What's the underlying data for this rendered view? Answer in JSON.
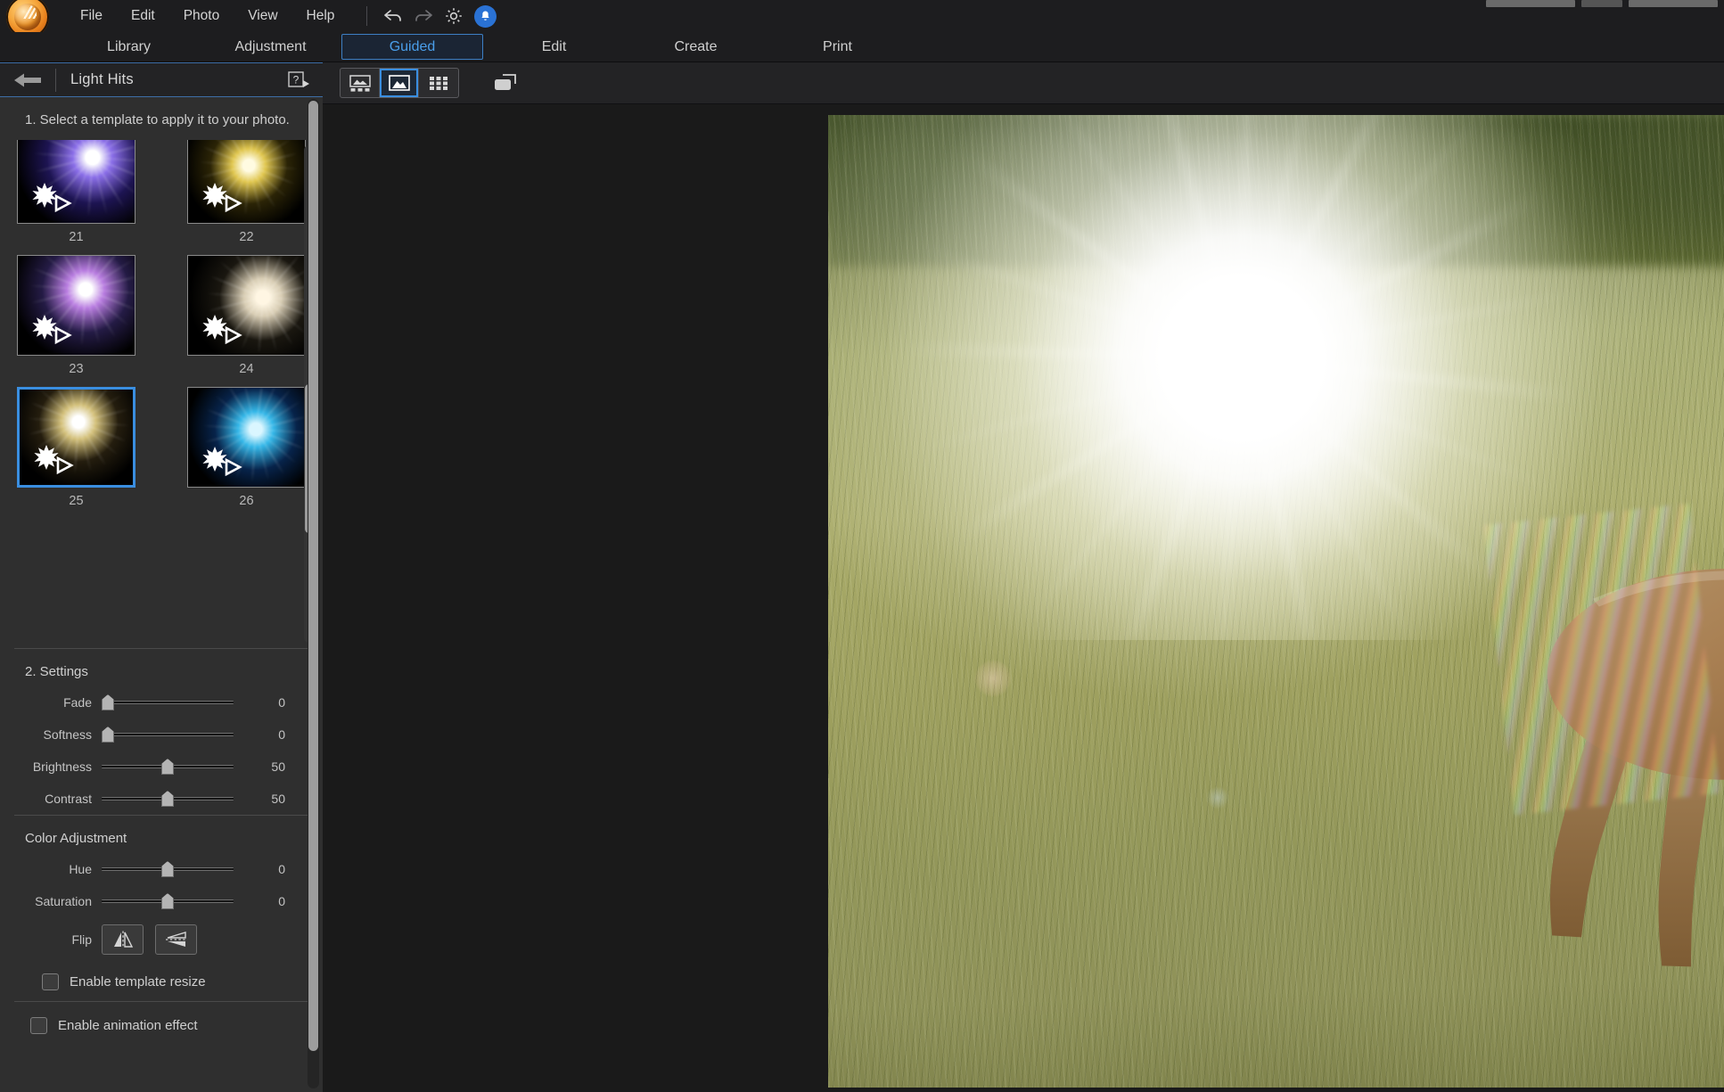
{
  "app": {
    "menu": [
      "File",
      "Edit",
      "Photo",
      "View",
      "Help"
    ],
    "icons": {
      "undo": "undo-icon",
      "redo": "redo-icon",
      "settings": "gear-icon",
      "notification": "bell-icon",
      "logo": "app-logo-icon"
    }
  },
  "tabs": [
    {
      "label": "Library",
      "active": false
    },
    {
      "label": "Adjustment",
      "active": false
    },
    {
      "label": "Guided",
      "active": true
    },
    {
      "label": "Edit",
      "active": false
    },
    {
      "label": "Create",
      "active": false
    },
    {
      "label": "Print",
      "active": false
    }
  ],
  "left_panel": {
    "back_icon": "back-arrow-icon",
    "title": "Light Hits",
    "help_icon": "help-question-icon",
    "step1_text": "1. Select a template to apply it to your photo.",
    "templates": [
      {
        "id": "19",
        "selected": false,
        "partial": true,
        "core": "#ffffff",
        "glow": "#7a5fd6",
        "tint": "#2a1b55"
      },
      {
        "id": "20",
        "selected": false,
        "partial": true,
        "core": "#ffffff",
        "glow": "#d9c24a",
        "tint": "#2a2408"
      },
      {
        "id": "21",
        "selected": false,
        "partial": false,
        "core": "#ffffff",
        "glow": "#8a6ee8",
        "tint": "#1d1452"
      },
      {
        "id": "22",
        "selected": false,
        "partial": false,
        "core": "#fffbe0",
        "glow": "#e0c64e",
        "tint": "#2b2406"
      },
      {
        "id": "23",
        "selected": false,
        "partial": false,
        "core": "#ffffff",
        "glow": "#b87ce0",
        "tint": "#241b45"
      },
      {
        "id": "24",
        "selected": false,
        "partial": false,
        "core": "#fff6e2",
        "glow": "#d8cdb4",
        "tint": "#1a1710"
      },
      {
        "id": "25",
        "selected": true,
        "partial": false,
        "core": "#ffffff",
        "glow": "#d3c07a",
        "tint": "#241d0e"
      },
      {
        "id": "26",
        "selected": false,
        "partial": false,
        "core": "#d8f6ff",
        "glow": "#34b7e8",
        "tint": "#07234a"
      }
    ],
    "settings_title": "2. Settings",
    "settings_sliders": [
      {
        "label": "Fade",
        "value": "0",
        "pct": 0
      },
      {
        "label": "Softness",
        "value": "0",
        "pct": 0
      },
      {
        "label": "Brightness",
        "value": "50",
        "pct": 50
      },
      {
        "label": "Contrast",
        "value": "50",
        "pct": 50
      }
    ],
    "color_title": "Color Adjustment",
    "color_sliders": [
      {
        "label": "Hue",
        "value": "0",
        "pct": 50
      },
      {
        "label": "Saturation",
        "value": "0",
        "pct": 50
      }
    ],
    "flip_label": "Flip",
    "flip_horizontal_icon": "flip-horizontal-icon",
    "flip_vertical_icon": "flip-vertical-icon",
    "enable_template_resize": "Enable template resize",
    "enable_animation_effect": "Enable animation effect",
    "template_resize_checked": false,
    "animation_effect_checked": false
  },
  "canvas": {
    "view_buttons": [
      {
        "name": "filmstrip-view-icon",
        "active": false
      },
      {
        "name": "single-photo-view-icon",
        "active": true
      },
      {
        "name": "grid-view-icon",
        "active": false
      }
    ],
    "compare_icon": "compare-before-after-icon",
    "photo_alt": "Deer standing in a sunlit grassy field with a bright lens-flare light hit applied"
  },
  "colors": {
    "accent": "#3a8ee0",
    "tab_active_text": "#4a9eea",
    "panel_bg": "#2f2f2f",
    "topbar_bg": "#1d1d1f",
    "canvas_bg": "#1a1a1a"
  }
}
